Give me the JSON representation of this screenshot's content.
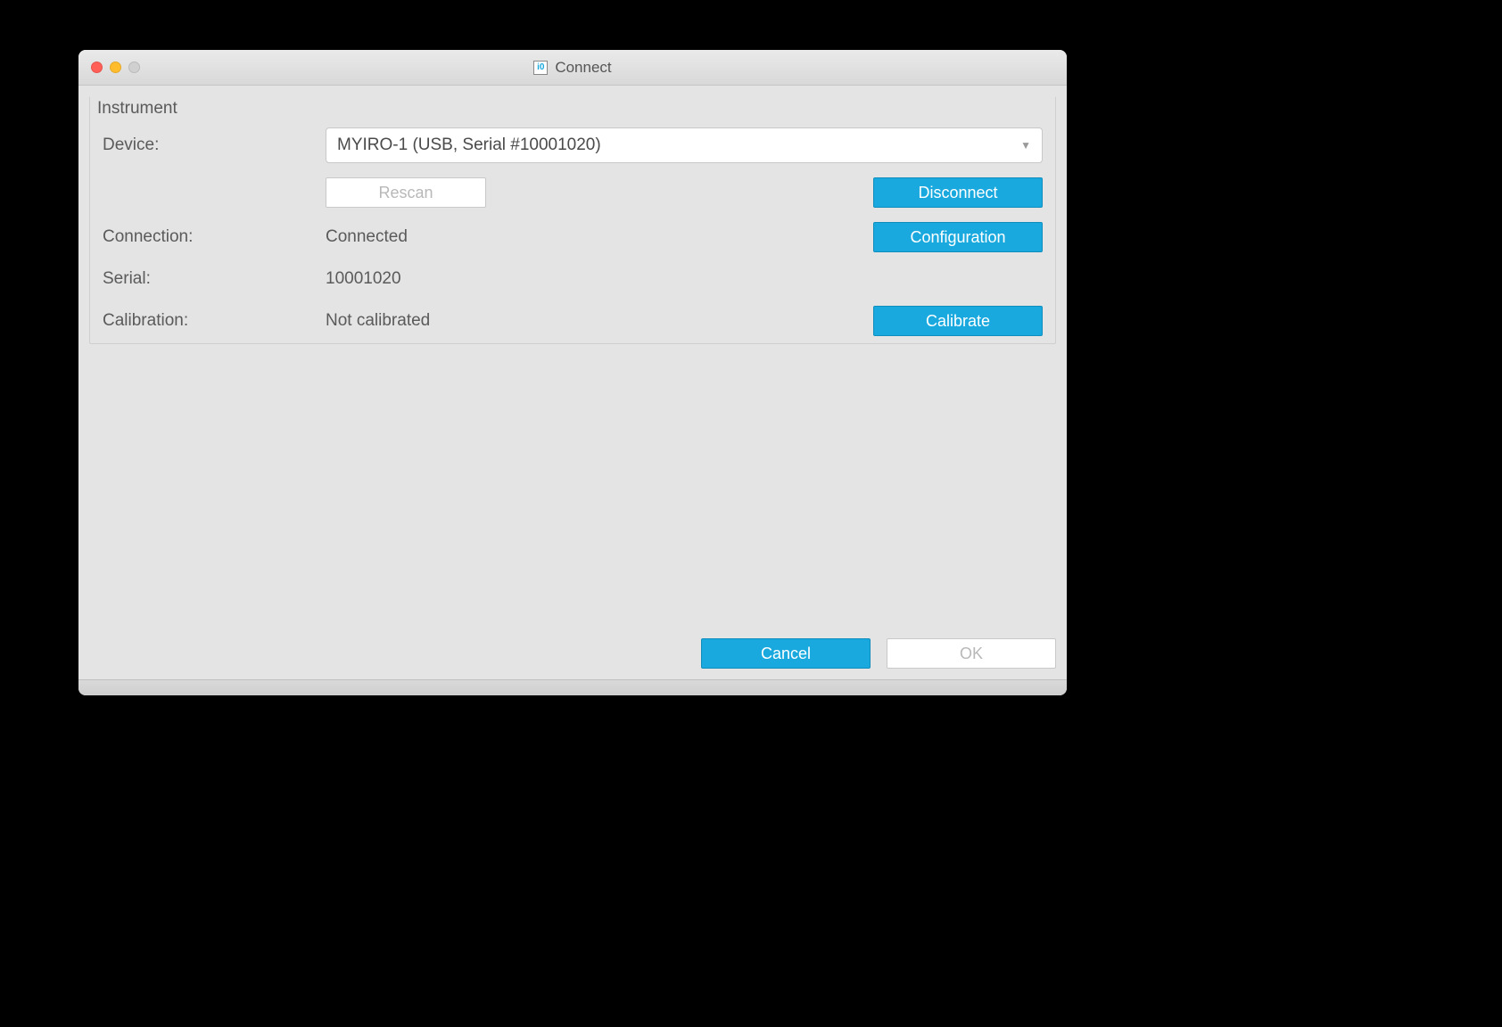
{
  "window": {
    "title": "Connect"
  },
  "group": {
    "title": "Instrument",
    "labels": {
      "device": "Device:",
      "connection": "Connection:",
      "serial": "Serial:",
      "calibration": "Calibration:"
    },
    "device_selected": "MYIRO-1 (USB, Serial #10001020)",
    "connection_value": "Connected",
    "serial_value": "10001020",
    "calibration_value": "Not calibrated",
    "buttons": {
      "rescan": "Rescan",
      "disconnect": "Disconnect",
      "configuration": "Configuration",
      "calibrate": "Calibrate"
    }
  },
  "footer": {
    "cancel": "Cancel",
    "ok": "OK"
  }
}
